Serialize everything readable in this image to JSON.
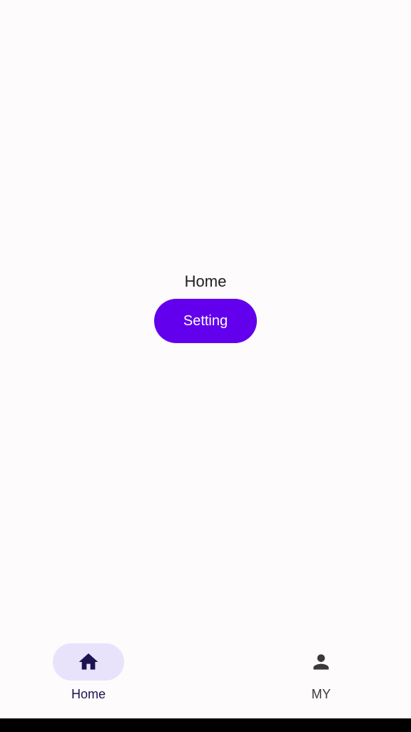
{
  "main": {
    "title": "Home",
    "button_label": "Setting"
  },
  "bottom_nav": {
    "items": [
      {
        "label": "Home",
        "icon": "home-icon",
        "selected": true
      },
      {
        "label": "MY",
        "icon": "person-icon",
        "selected": false
      }
    ]
  },
  "colors": {
    "background": "#fdfbfc",
    "primary": "#6200ee",
    "indicator": "#e9e2fb",
    "active_icon": "#1c1450",
    "inactive_icon": "#3a3a3a"
  }
}
